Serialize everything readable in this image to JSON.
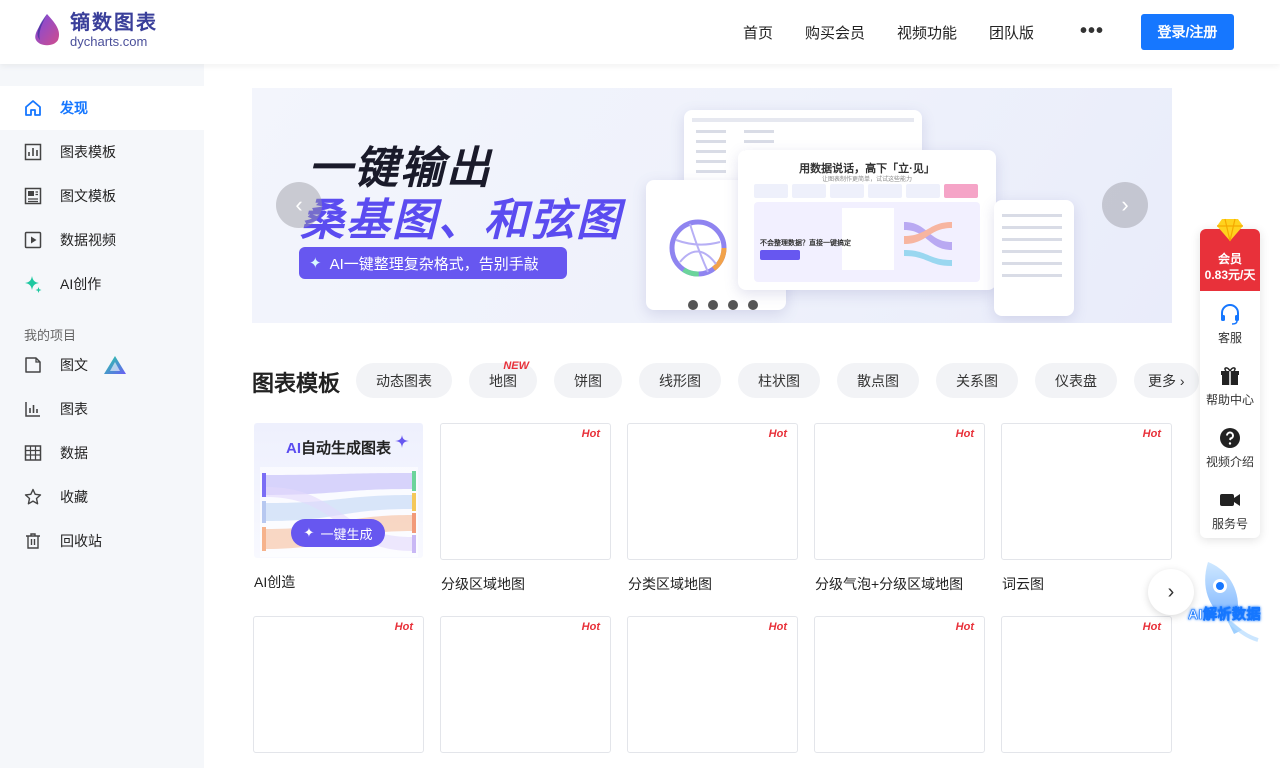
{
  "logo": {
    "title": "镝数图表",
    "subtitle": "dycharts.com"
  },
  "nav": {
    "items": [
      "首页",
      "购买会员",
      "视频功能",
      "团队版"
    ],
    "more": "•••",
    "login": "登录/注册"
  },
  "sidebar": {
    "main": [
      {
        "label": "发现",
        "icon": "home-icon",
        "active": true
      },
      {
        "label": "图表模板",
        "icon": "chart-template-icon"
      },
      {
        "label": "图文模板",
        "icon": "infographic-template-icon"
      },
      {
        "label": "数据视频",
        "icon": "video-icon"
      },
      {
        "label": "AI创作",
        "icon": "ai-sparkle-icon"
      }
    ],
    "section_title": "我的项目",
    "projects": [
      {
        "label": "图文",
        "icon": "folder-icon"
      },
      {
        "label": "图表",
        "icon": "bar-chart-icon"
      },
      {
        "label": "数据",
        "icon": "table-icon"
      },
      {
        "label": "收藏",
        "icon": "star-icon"
      },
      {
        "label": "回收站",
        "icon": "trash-icon"
      }
    ]
  },
  "banner": {
    "headline": "一键输出",
    "subheadline": "桑基图、和弦图",
    "pill": "AI一键整理复杂格式，告别手敲",
    "prev": "‹",
    "next": "›",
    "mock_title": "用数据说话，高下「立·见」",
    "mock_sub": "让图表制作更简单，试试这些能力",
    "mock_prompt": "不会整理数据？直接一键搞定"
  },
  "templates": {
    "title": "图表模板",
    "tags": [
      {
        "label": "动态图表"
      },
      {
        "label": "地图",
        "badge": "NEW"
      },
      {
        "label": "饼图"
      },
      {
        "label": "线形图"
      },
      {
        "label": "柱状图"
      },
      {
        "label": "散点图"
      },
      {
        "label": "关系图"
      },
      {
        "label": "仪表盘"
      },
      {
        "label": "更多 ›"
      }
    ],
    "ai_card": {
      "title_prefix": "AI",
      "title_rest": "自动生成图表",
      "button": "一键生成",
      "label": "AI创造"
    },
    "row1": [
      "分级区域地图",
      "分类区域地图",
      "分级气泡+分级区域地图",
      "词云图"
    ],
    "hot": "Hot",
    "next": "›"
  },
  "float_panel": {
    "vip_title": "会员",
    "vip_price": "0.83元/天",
    "items": [
      "客服",
      "帮助中心",
      "视频介绍",
      "服务号"
    ]
  },
  "ai_analysis": "AI解析数据"
}
